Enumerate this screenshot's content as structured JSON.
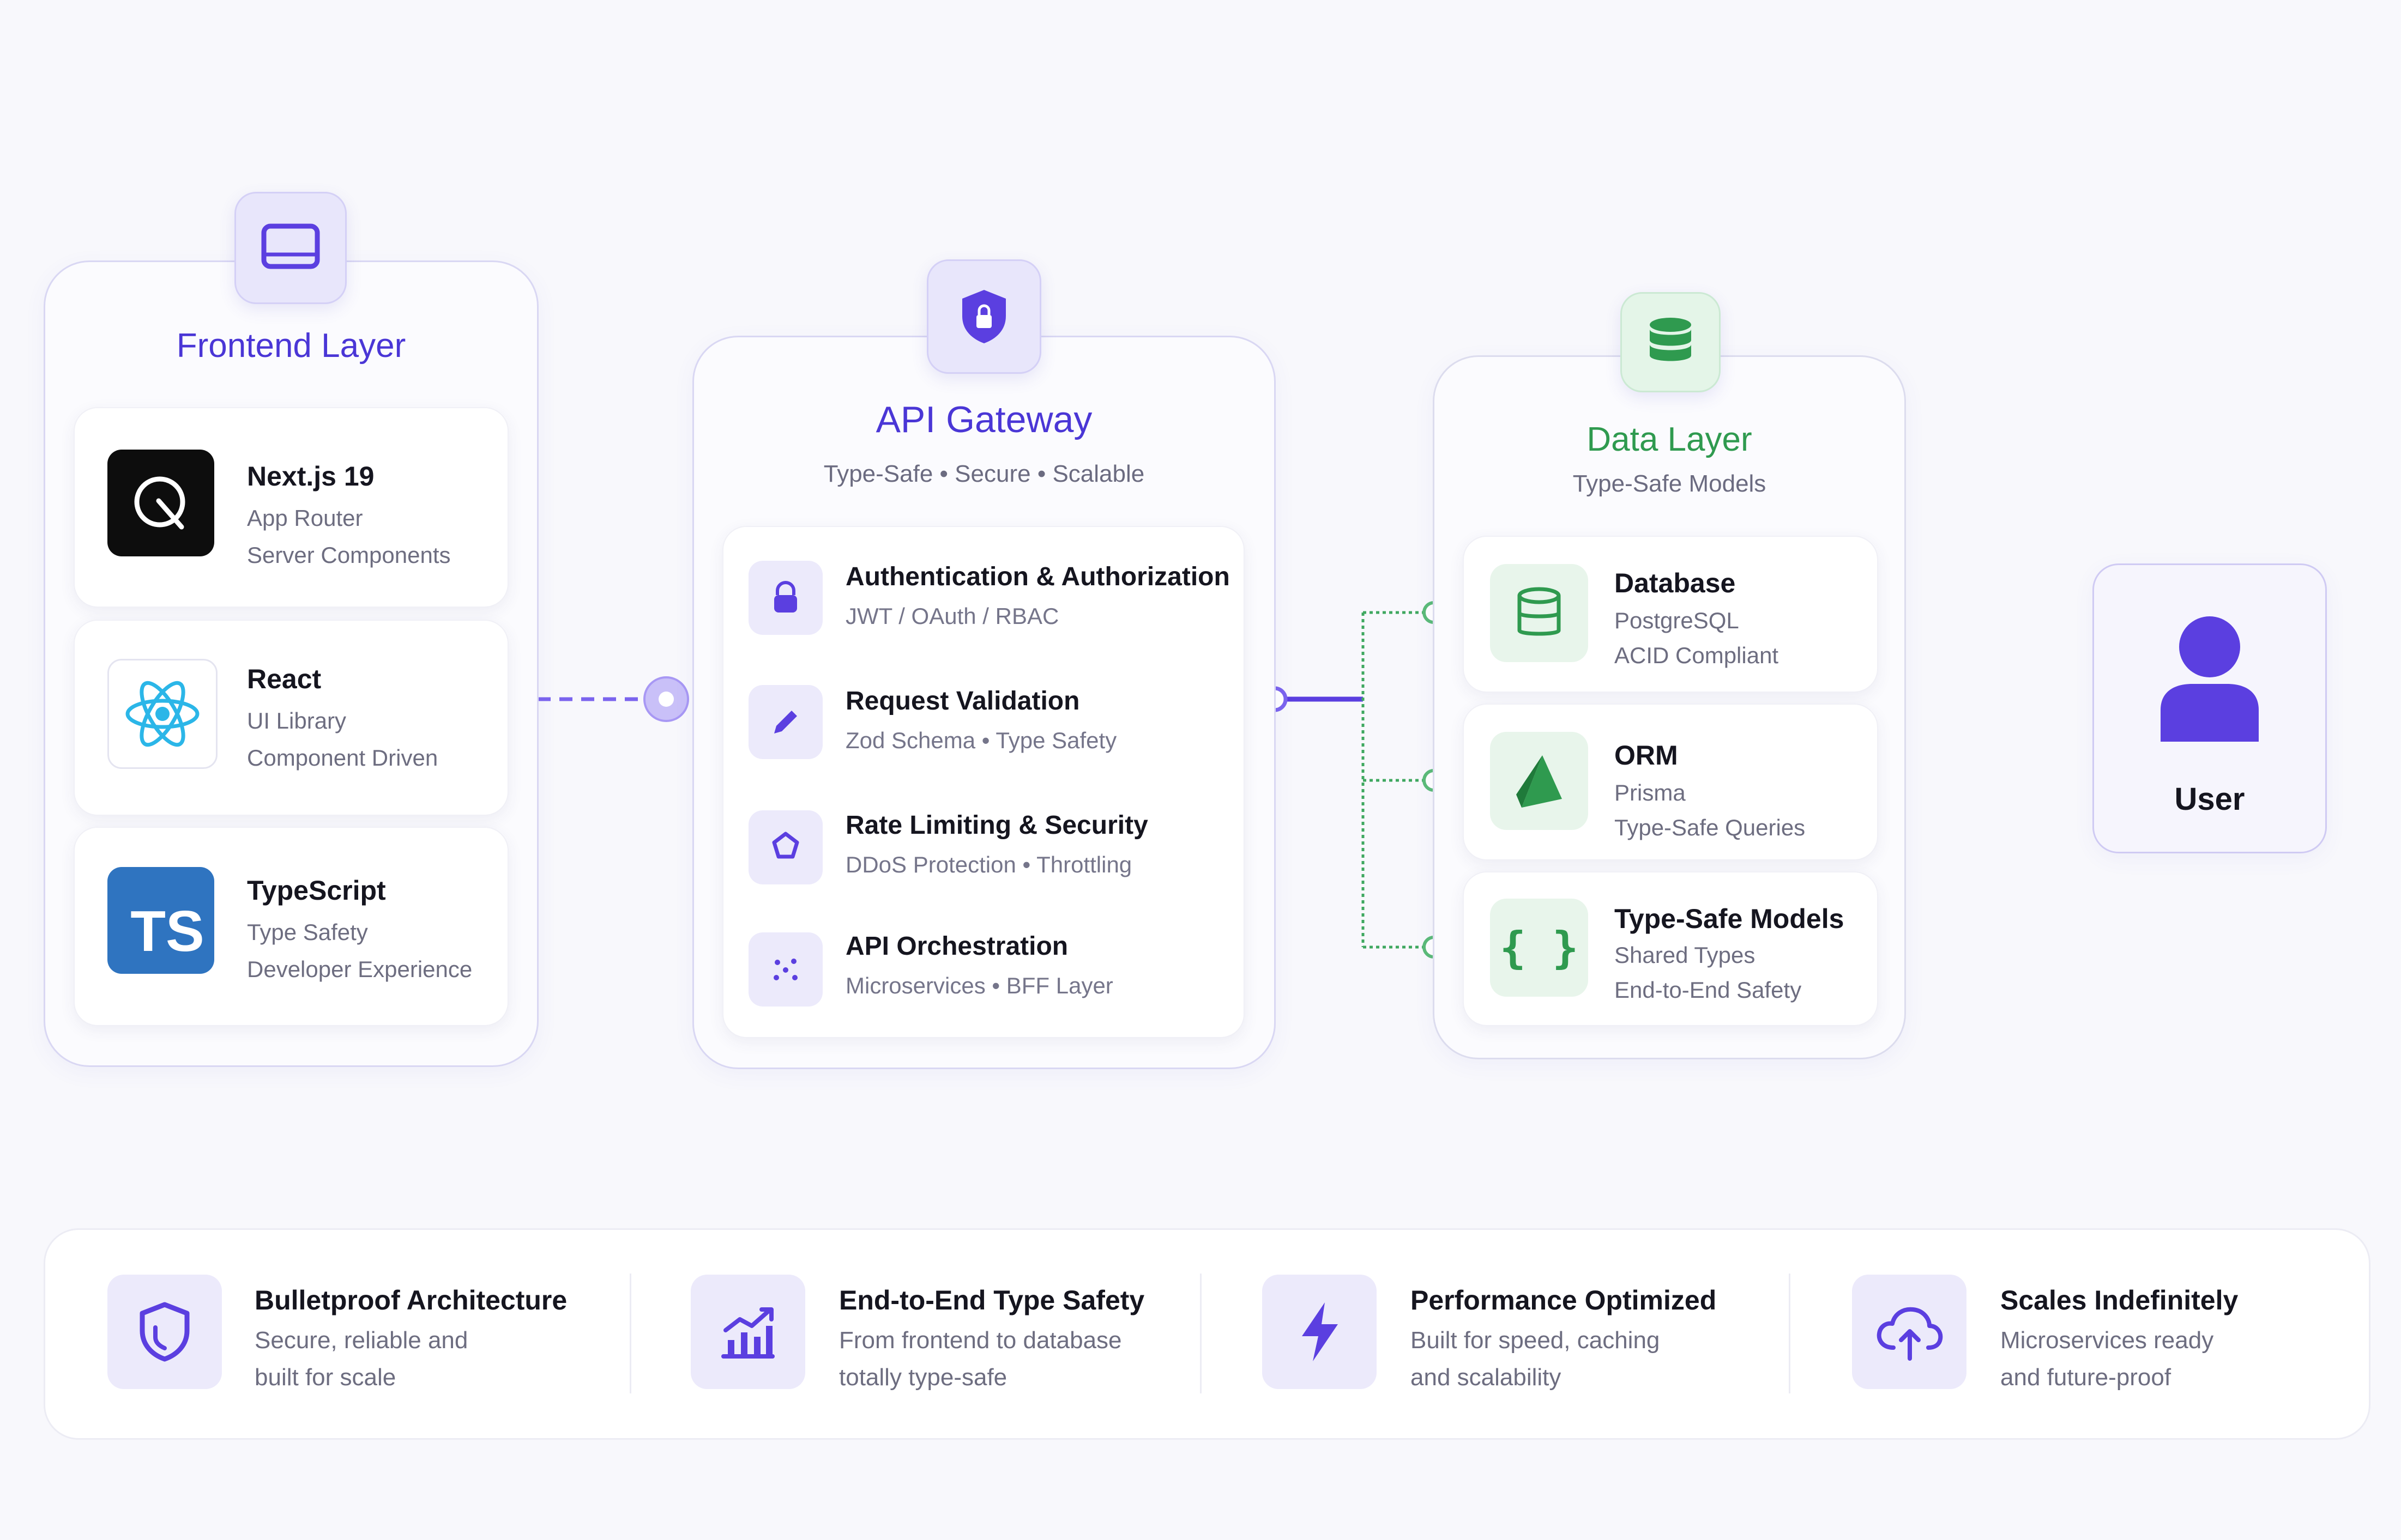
{
  "frontend": {
    "title": "Frontend Layer",
    "items": [
      {
        "title": "Next.js 19",
        "line1": "App Router",
        "line2": "Server Components",
        "icon": "nextjs-logo-icon"
      },
      {
        "title": "React",
        "line1": "UI Library",
        "line2": "Component Driven",
        "icon": "react-logo-icon"
      },
      {
        "title": "TypeScript",
        "line1": "Type Safety",
        "line2": "Developer Experience",
        "icon": "typescript-logo-icon",
        "logo_text": "TS"
      }
    ]
  },
  "gateway": {
    "title": "API Gateway",
    "subtitle": "Type-Safe • Secure • Scalable",
    "items": [
      {
        "title": "Authentication & Authorization",
        "subtitle": "JWT / OAuth / RBAC",
        "icon": "lock-icon"
      },
      {
        "title": "Request Validation",
        "subtitle": "Zod Schema • Type Safety",
        "icon": "pencil-icon"
      },
      {
        "title": "Rate Limiting & Security",
        "subtitle": "DDoS Protection • Throttling",
        "icon": "shield-icon"
      },
      {
        "title": "API Orchestration",
        "subtitle": "Microservices • BFF Layer",
        "icon": "nodes-icon"
      }
    ]
  },
  "data_layer": {
    "title": "Data Layer",
    "subtitle": "Type-Safe Models",
    "items": [
      {
        "title": "Database",
        "line1": "PostgreSQL",
        "line2": "ACID Compliant",
        "icon": "database-icon"
      },
      {
        "title": "ORM",
        "line1": "Prisma",
        "line2": "Type-Safe Queries",
        "icon": "prisma-logo-icon"
      },
      {
        "title": "Type-Safe Models",
        "line1": "Shared Types",
        "line2": "End-to-End Safety",
        "icon": "braces-icon",
        "glyph": "{ }"
      }
    ]
  },
  "user": {
    "label": "User",
    "icon": "user-icon"
  },
  "features": [
    {
      "title": "Bulletproof Architecture",
      "line1": "Secure, reliable and",
      "line2": "built for scale",
      "icon": "shield-icon"
    },
    {
      "title": "End-to-End Type Safety",
      "line1": "From frontend to database",
      "line2": "totally type-safe",
      "icon": "chart-icon"
    },
    {
      "title": "Performance Optimized",
      "line1": "Built for speed, caching",
      "line2": "and scalability",
      "icon": "lightning-icon"
    },
    {
      "title": "Scales Indefinitely",
      "line1": "Microservices ready",
      "line2": "and future-proof",
      "icon": "cloud-icon"
    }
  ],
  "colors": {
    "accent": "#5b3fe0",
    "green": "#2f9a4f",
    "background": "#f8f8fc"
  }
}
